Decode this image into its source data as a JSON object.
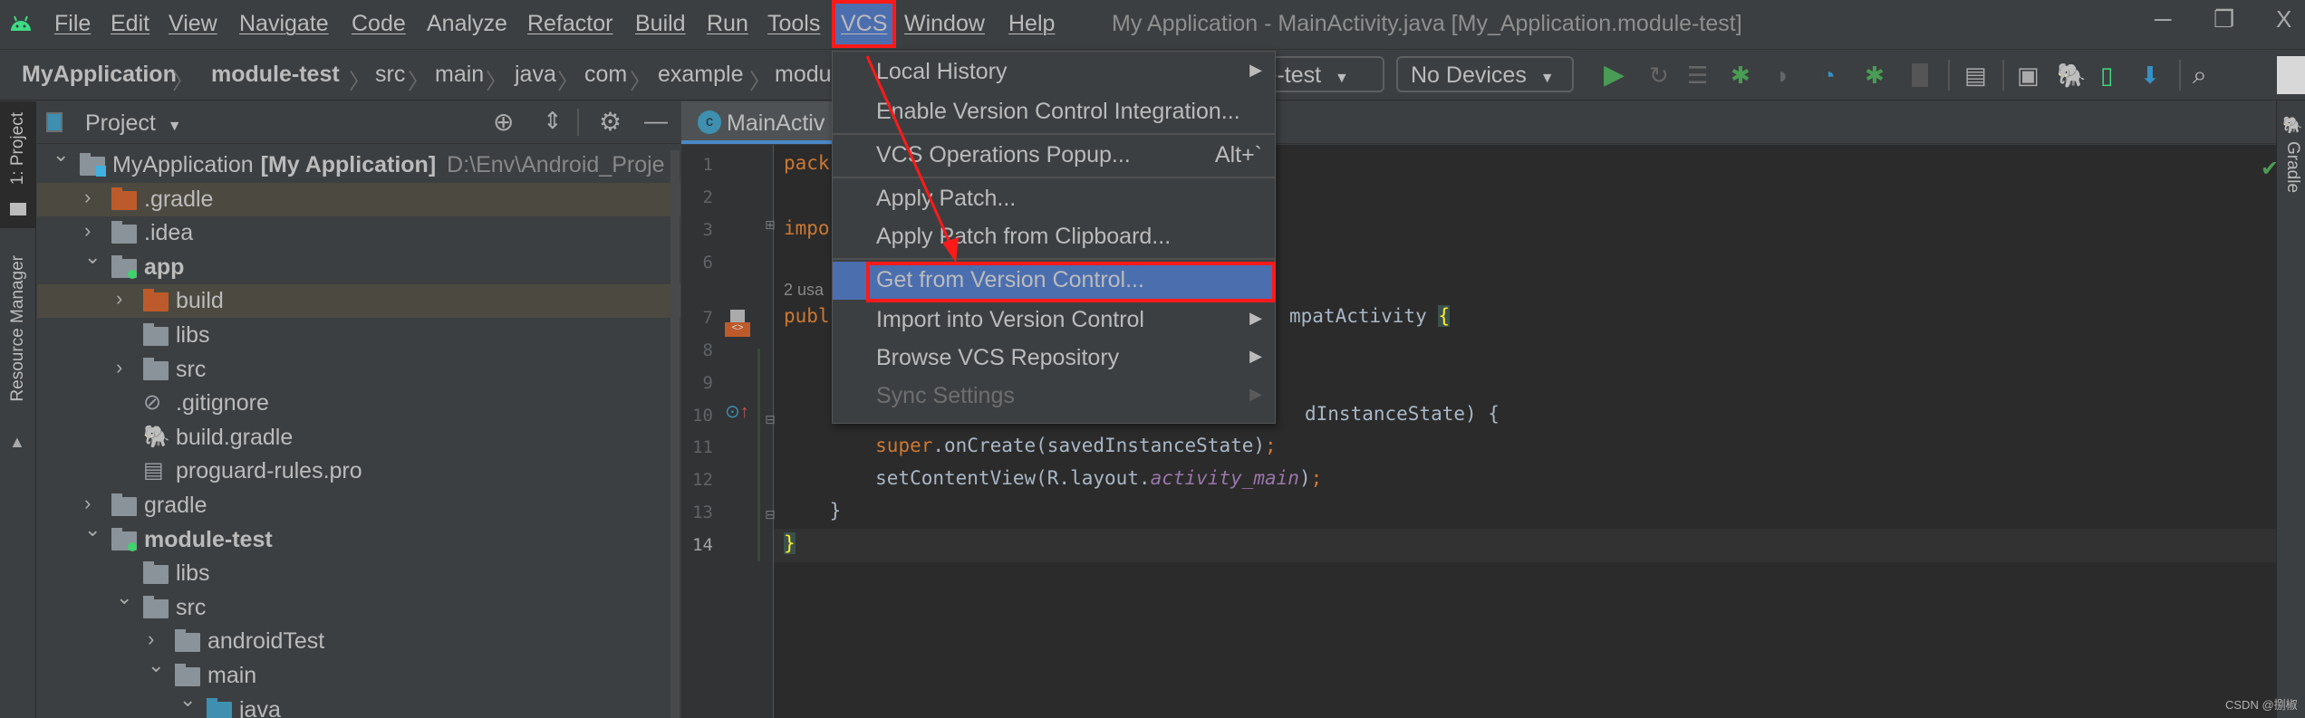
{
  "menubar": {
    "items": [
      "File",
      "Edit",
      "View",
      "Navigate",
      "Code",
      "Analyze",
      "Refactor",
      "Build",
      "Run",
      "Tools",
      "VCS",
      "Window",
      "Help"
    ],
    "active": "VCS",
    "title": "My Application - MainActivity.java [My_Application.module-test]",
    "window_controls": {
      "minimize": "─",
      "restore": "❐",
      "close": "X"
    }
  },
  "navbar": {
    "breadcrumb": [
      "MyApplication",
      "module-test",
      "src",
      "main",
      "java",
      "com",
      "example",
      "modu"
    ],
    "run_config_visible": "le-test",
    "device": "No Devices",
    "toolbar_icons": [
      "run-icon",
      "rerun-icon",
      "apply-changes-icon",
      "debug-icon",
      "attach-icon",
      "profile-icon",
      "attach-debugger-icon",
      "stop-icon",
      "project-structure-icon",
      "layout-inspector-icon",
      "gradle-sync-icon",
      "avd-manager-icon",
      "sdk-manager-icon",
      "search-icon",
      "avatar-icon"
    ]
  },
  "left_strip": {
    "project_tab": "1: Project",
    "resource_manager_tab": "Resource Manager"
  },
  "right_strip": {
    "gradle_tab": "Gradle"
  },
  "project_panel": {
    "title": "Project",
    "tree": [
      {
        "label": "MyApplication",
        "bold_suffix": "[My Application]",
        "path": "D:\\Env\\Android_Proje",
        "level": 0,
        "state": "open",
        "icon": "project"
      },
      {
        "label": ".gradle",
        "level": 1,
        "state": "closed",
        "icon": "folder-excluded",
        "highlight": true
      },
      {
        "label": ".idea",
        "level": 1,
        "state": "closed",
        "icon": "folder"
      },
      {
        "label": "app",
        "level": 1,
        "state": "open",
        "icon": "module",
        "bold": true
      },
      {
        "label": "build",
        "level": 2,
        "state": "closed",
        "icon": "folder-excluded",
        "highlight": true
      },
      {
        "label": "libs",
        "level": 2,
        "state": "none",
        "icon": "folder"
      },
      {
        "label": "src",
        "level": 2,
        "state": "closed",
        "icon": "folder"
      },
      {
        "label": ".gitignore",
        "level": 2,
        "state": "none",
        "icon": "ignored-file"
      },
      {
        "label": "build.gradle",
        "level": 2,
        "state": "none",
        "icon": "gradle-file"
      },
      {
        "label": "proguard-rules.pro",
        "level": 2,
        "state": "none",
        "icon": "text-file"
      },
      {
        "label": "gradle",
        "level": 1,
        "state": "closed",
        "icon": "folder"
      },
      {
        "label": "module-test",
        "level": 1,
        "state": "open",
        "icon": "module",
        "bold": true
      },
      {
        "label": "libs",
        "level": 2,
        "state": "none",
        "icon": "folder"
      },
      {
        "label": "src",
        "level": 2,
        "state": "open",
        "icon": "folder"
      },
      {
        "label": "androidTest",
        "level": 3,
        "state": "closed",
        "icon": "folder"
      },
      {
        "label": "main",
        "level": 3,
        "state": "open",
        "icon": "folder"
      },
      {
        "label": "java",
        "level": 4,
        "state": "open",
        "icon": "folder-source"
      }
    ]
  },
  "editor": {
    "tab": "MainActiv",
    "lines": [
      {
        "n": "1",
        "parts": [
          {
            "t": "pack",
            "c": "kw"
          }
        ]
      },
      {
        "n": "2",
        "parts": []
      },
      {
        "n": "3",
        "parts": [
          {
            "t": "impo",
            "c": "kw"
          }
        ]
      },
      {
        "n": "6",
        "parts": []
      },
      {
        "n": "",
        "hint": "2 usa"
      },
      {
        "n": "7",
        "parts": [
          {
            "t": "publ",
            "c": "kw"
          }
        ],
        "tail": [
          {
            "t": "mpatActivity ",
            "c": ""
          },
          {
            "t": "{",
            "c": "br"
          }
        ]
      },
      {
        "n": "8",
        "parts": []
      },
      {
        "n": "9",
        "parts": []
      },
      {
        "n": "10",
        "parts": [],
        "tail": [
          {
            "t": "dInstanceState) {",
            "c": ""
          }
        ]
      },
      {
        "n": "11",
        "parts": [
          {
            "t": "        ",
            "c": ""
          },
          {
            "t": "super",
            "c": "kw"
          },
          {
            "t": ".onCreate(savedInstanceState)",
            "c": ""
          },
          {
            "t": ";",
            "c": "kw"
          }
        ]
      },
      {
        "n": "12",
        "parts": [
          {
            "t": "        setContentView(R.layout.",
            "c": ""
          },
          {
            "t": "activity_main",
            "c": "it"
          },
          {
            "t": ")",
            "c": ""
          },
          {
            "t": ";",
            "c": "kw"
          }
        ]
      },
      {
        "n": "13",
        "parts": [
          {
            "t": "    }",
            "c": ""
          }
        ]
      },
      {
        "n": "14",
        "parts": [
          {
            "t": "}",
            "c": "br"
          }
        ]
      }
    ],
    "status": "no-problems"
  },
  "vcs_menu": {
    "items": [
      {
        "label": "Local History",
        "submenu": true
      },
      {
        "label": "Enable Version Control Integration..."
      },
      {
        "separator": true
      },
      {
        "label": "VCS Operations Popup...",
        "shortcut": "Alt+`"
      },
      {
        "separator": true
      },
      {
        "label": "Apply Patch..."
      },
      {
        "label": "Apply Patch from Clipboard..."
      },
      {
        "separator": true
      },
      {
        "label": "Get from Version Control...",
        "selected": true
      },
      {
        "label": "Import into Version Control",
        "submenu": true
      },
      {
        "label": "Browse VCS Repository",
        "submenu": true
      },
      {
        "label": "Sync Settings",
        "submenu": true,
        "disabled": true
      }
    ]
  },
  "annotation_color": "#ff1a1a",
  "selection_color": "#4b6eaf",
  "watermark": "CSDN @捌椒"
}
